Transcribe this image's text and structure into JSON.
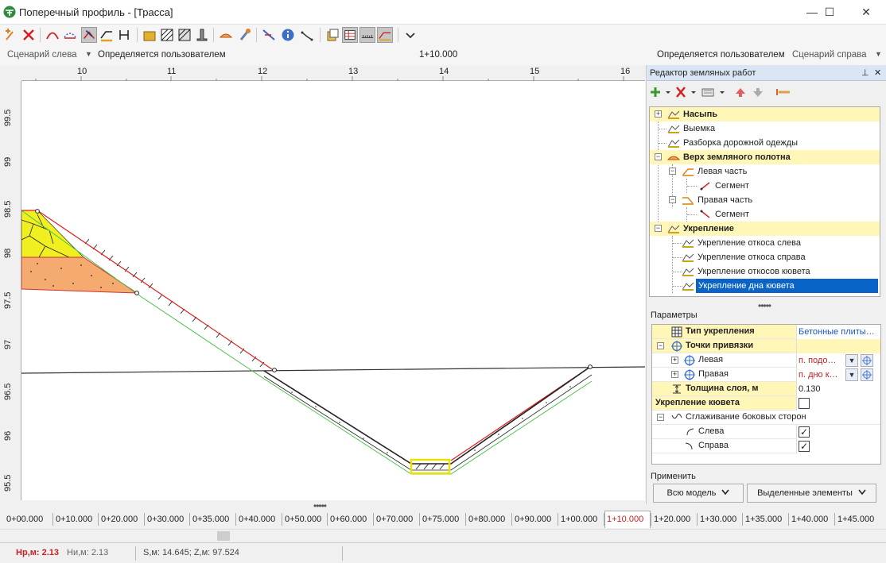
{
  "window": {
    "title": "Поперечный профиль - [Трасса]",
    "minimize": "—",
    "maximize": "☐",
    "close": "✕"
  },
  "toolbar": {
    "icons": [
      "add-point-icon",
      "delete-point-icon",
      "arc-icon",
      "arc-dashed-icon",
      "select-slope-icon",
      "layers-icon",
      "cut-icon",
      "box-icon",
      "hatch-icon",
      "hatch2-icon",
      "pillar-icon",
      "cap-icon",
      "brush-icon",
      "measure-icon",
      "info-icon",
      "line-icon",
      "copy-icon",
      "table-icon",
      "ruler-icon",
      "earthwork-icon",
      "more-icon"
    ]
  },
  "scenario": {
    "left_label": "Сценарий слева",
    "left_value": "Определяется пользователем",
    "station": "1+10.000",
    "right_value": "Определяется пользователем",
    "right_label": "Сценарий справа"
  },
  "ruler": {
    "x_ticks": [
      "10",
      "11",
      "12",
      "13",
      "14",
      "15",
      "16"
    ],
    "y_ticks": [
      "99.5",
      "99",
      "98.5",
      "98",
      "97.5",
      "97",
      "96.5",
      "96",
      "95.5"
    ]
  },
  "panel": {
    "title": "Редактор земляных работ",
    "pin": "⊥",
    "close": "✕",
    "tree": [
      {
        "label": "Насыпь",
        "group": true,
        "exp": "+"
      },
      {
        "label": "Выемка"
      },
      {
        "label": "Разборка дорожной одежды"
      },
      {
        "label": "Верх земляного полотна",
        "group": true,
        "exp": "−"
      },
      {
        "label": "Левая часть",
        "exp": "−"
      },
      {
        "label": "Сегмент"
      },
      {
        "label": "Правая часть",
        "exp": "−"
      },
      {
        "label": "Сегмент"
      },
      {
        "label": "Укрепление",
        "group": true,
        "exp": "−"
      },
      {
        "label": "Укрепление откоса слева"
      },
      {
        "label": "Укрепление откоса справа"
      },
      {
        "label": "Укрепление откосов кювета"
      },
      {
        "label": "Укрепление дна кювета",
        "selected": true
      }
    ],
    "params_label": "Параметры",
    "params": {
      "type_label": "Тип укрепления",
      "type_value": "Бетонные плиты…",
      "points_label": "Точки привязки",
      "left_label": "Левая",
      "left_value": "п. подо…",
      "right_label": "Правая",
      "right_value": "п. дно к…",
      "thickness_label": "Толщина слоя, м",
      "thickness_value": "0.130",
      "ditch_label": "Укрепление кювета",
      "smoothing_label": "Сглаживание боковых сторон",
      "smooth_left_label": "Слева",
      "smooth_right_label": "Справа",
      "check": "✓"
    },
    "apply_label": "Применить",
    "apply_all": "Всю модель",
    "apply_selected": "Выделенные элементы"
  },
  "stations": [
    "0+00.000",
    "0+10.000",
    "0+20.000",
    "0+30.000",
    "0+35.000",
    "0+40.000",
    "0+50.000",
    "0+60.000",
    "0+70.000",
    "0+75.000",
    "0+80.000",
    "0+90.000",
    "1+00.000",
    "1+10.000",
    "1+20.000",
    "1+30.000",
    "1+35.000",
    "1+40.000",
    "1+45.000"
  ],
  "active_station_index": 13,
  "status": {
    "hr": "Нр,м: 2.13",
    "hi": "Ни,м: 2.13",
    "sz": "S,м: 14.645;  Z,м: 97.524"
  },
  "colors": {
    "accent_red": "#c82020",
    "selection_blue": "#0a64c8",
    "group_yellow": "#fff6b8",
    "slope_red": "#e02020",
    "slope_green": "#4cc44c",
    "soil_yellow": "#f0f020",
    "soil_orange": "#f5aa70"
  }
}
